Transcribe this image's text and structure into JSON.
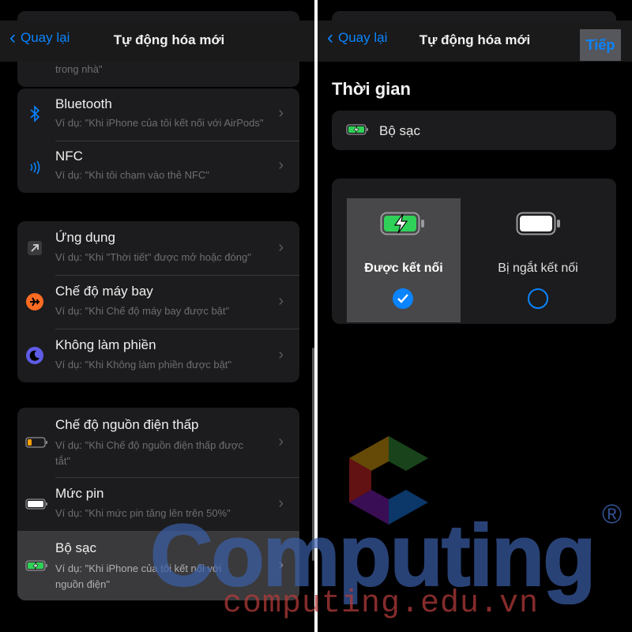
{
  "left": {
    "nav": {
      "back_label": "Quay lại",
      "title": "Tự động hóa mới"
    },
    "top_partial_subtitle": "trong nhà\"",
    "groups": [
      {
        "items": [
          {
            "title": "Bluetooth",
            "subtitle": "Ví dụ: \"Khi iPhone của tôi kết nối với AirPods\"",
            "icon": "bluetooth-icon"
          },
          {
            "title": "NFC",
            "subtitle": "Ví dụ: \"Khi tôi chạm vào thẻ NFC\"",
            "icon": "nfc-icon"
          }
        ]
      },
      {
        "items": [
          {
            "title": "Ứng dụng",
            "subtitle": "Ví dụ: \"Khi \"Thời tiết\" được mở hoặc đóng\"",
            "icon": "app-arrow-icon"
          },
          {
            "title": "Chế độ máy bay",
            "subtitle": "Ví dụ: \"Khi Chế độ máy bay được bật\"",
            "icon": "airplane-icon"
          },
          {
            "title": "Không làm phiền",
            "subtitle": "Ví dụ: \"Khi Không làm phiền được bật\"",
            "icon": "moon-icon"
          }
        ]
      },
      {
        "items": [
          {
            "title": "Chế độ nguồn điện thấp",
            "subtitle": "Ví dụ: \"Khi Chế độ nguồn điện thấp được tắt\"",
            "icon": "low-battery-icon"
          },
          {
            "title": "Mức pin",
            "subtitle": "Ví dụ: \"Khi mức pin tăng lên trên 50%\"",
            "icon": "battery-icon"
          },
          {
            "title": "Bộ sạc",
            "subtitle": "Ví dụ: \"Khi iPhone của tôi kết nối với nguồn điện\"",
            "icon": "charging-battery-icon",
            "highlighted": true
          }
        ]
      }
    ]
  },
  "right": {
    "nav": {
      "back_label": "Quay lại",
      "title": "Tự động hóa mới",
      "next_label": "Tiếp"
    },
    "section_title": "Thời gian",
    "trigger_label": "Bộ sạc",
    "options": [
      {
        "label": "Được kết nối",
        "selected": true
      },
      {
        "label": "Bị ngắt kết nối",
        "selected": false
      }
    ]
  },
  "watermark": {
    "brand": "Computing",
    "url": "computing.edu.vn",
    "mark": "®"
  },
  "colors": {
    "accent": "#0a84ff",
    "background": "#000000",
    "cell": "#1c1c1e",
    "battery_green": "#30d158",
    "airplane_orange": "#ff6b22",
    "moon_purple": "#5e5ce6"
  }
}
